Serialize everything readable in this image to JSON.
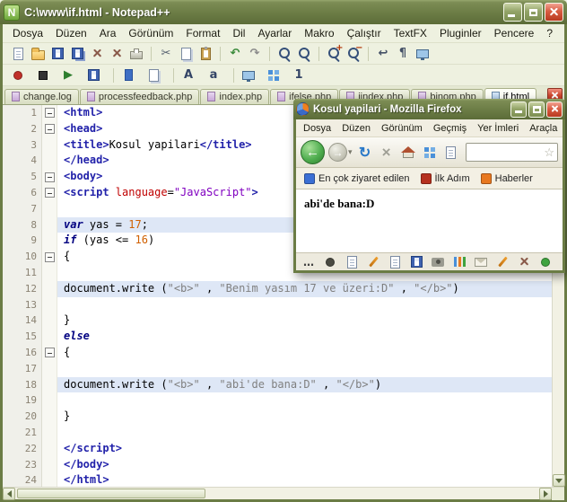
{
  "notepad": {
    "title": "C:\\www\\if.html - Notepad++",
    "app_icon_letter": "N",
    "menu_items": [
      "Dosya",
      "Düzen",
      "Ara",
      "Görünüm",
      "Format",
      "Dil",
      "Ayarlar",
      "Makro",
      "Çalıştır",
      "TextFX",
      "Pluginler",
      "Pencere",
      "?"
    ],
    "toolbar_row1": [
      {
        "name": "new-file-icon",
        "kind": "page"
      },
      {
        "name": "open-file-icon",
        "kind": "folder"
      },
      {
        "name": "save-icon",
        "kind": "floppy"
      },
      {
        "name": "save-all-icon",
        "kind": "floppy2"
      },
      {
        "name": "close-file-icon",
        "kind": "xgray"
      },
      {
        "name": "close-all-icon",
        "kind": "xgray"
      },
      {
        "name": "print-icon",
        "kind": "printer"
      },
      {
        "sep": true
      },
      {
        "name": "cut-icon",
        "kind": "char",
        "glyph": "✂",
        "color": "#556070"
      },
      {
        "name": "copy-icon",
        "kind": "page2"
      },
      {
        "name": "paste-icon",
        "kind": "clipboard"
      },
      {
        "sep": true
      },
      {
        "name": "undo-icon",
        "kind": "char",
        "glyph": "↶",
        "color": "#3A8A3A"
      },
      {
        "name": "redo-icon",
        "kind": "char",
        "glyph": "↷",
        "color": "#8A8A8A"
      },
      {
        "sep": true
      },
      {
        "name": "find-icon",
        "kind": "zoom"
      },
      {
        "name": "find-replace-icon",
        "kind": "zoom"
      },
      {
        "sep": true
      },
      {
        "name": "zoom-in-icon",
        "kind": "zoom",
        "glyph": "+"
      },
      {
        "name": "zoom-out-icon",
        "kind": "zoom",
        "glyph": "−"
      },
      {
        "sep": true
      },
      {
        "name": "word-wrap-icon",
        "kind": "char",
        "glyph": "↩",
        "color": "#445066"
      },
      {
        "name": "show-symbols-icon",
        "kind": "char",
        "glyph": "¶",
        "color": "#445066"
      },
      {
        "name": "doc-monitor-icon",
        "kind": "monitor"
      }
    ],
    "toolbar_row2": [
      {
        "name": "macro-record-icon",
        "kind": "dot",
        "color": "#C03028"
      },
      {
        "name": "macro-stop-icon",
        "kind": "stopsq"
      },
      {
        "name": "macro-play-icon",
        "kind": "char",
        "glyph": "▶",
        "color": "#2E7E2E"
      },
      {
        "name": "macro-save-icon",
        "kind": "floppy"
      },
      {
        "sep": true
      },
      {
        "name": "bookmark-icon",
        "kind": "bookmarkic"
      },
      {
        "name": "doc-pair-icon",
        "kind": "page2"
      },
      {
        "sep": true
      },
      {
        "name": "uppercase-icon",
        "kind": "char",
        "glyph": "A",
        "color": "#334466"
      },
      {
        "name": "lowercase-icon",
        "kind": "char",
        "glyph": "a",
        "color": "#334466"
      },
      {
        "sep": true
      },
      {
        "name": "doc-map-icon",
        "kind": "monitor"
      },
      {
        "name": "function-list-icon",
        "kind": "grid"
      },
      {
        "name": "doc-switcher-icon",
        "kind": "char",
        "glyph": "1",
        "color": "#334466"
      }
    ],
    "tabs": [
      {
        "label": "change.log",
        "active": false
      },
      {
        "label": "processfeedback.php",
        "active": false
      },
      {
        "label": "index.php",
        "active": false
      },
      {
        "label": "ifelse.php",
        "active": false
      },
      {
        "label": "iindex.php",
        "active": false
      },
      {
        "label": "binom.php",
        "active": false
      },
      {
        "label": "if.html",
        "active": true
      }
    ],
    "editor": {
      "lines": [
        {
          "n": 1,
          "fold": true,
          "segs": [
            {
              "t": "<html>",
              "c": "t"
            }
          ]
        },
        {
          "n": 2,
          "fold": true,
          "segs": [
            {
              "t": "<head>",
              "c": "t"
            }
          ]
        },
        {
          "n": 3,
          "segs": [
            {
              "t": "<title>",
              "c": "t"
            },
            {
              "t": "Kosul yapilari",
              "c": "p"
            },
            {
              "t": "</title>",
              "c": "t"
            }
          ]
        },
        {
          "n": 4,
          "segs": [
            {
              "t": "</head>",
              "c": "t"
            }
          ]
        },
        {
          "n": 5,
          "fold": true,
          "segs": [
            {
              "t": "<body>",
              "c": "t"
            }
          ]
        },
        {
          "n": 6,
          "fold": true,
          "segs": [
            {
              "t": "<script ",
              "c": "t"
            },
            {
              "t": "language",
              "c": "a"
            },
            {
              "t": "=",
              "c": "p"
            },
            {
              "t": "\"JavaScript\"",
              "c": "v"
            },
            {
              "t": ">",
              "c": "t"
            }
          ]
        },
        {
          "n": 7,
          "segs": []
        },
        {
          "n": 8,
          "hl": true,
          "segs": [
            {
              "t": "var",
              "c": "k"
            },
            {
              "t": " yas = ",
              "c": "p"
            },
            {
              "t": "17",
              "c": "n"
            },
            {
              "t": ";",
              "c": "p"
            }
          ]
        },
        {
          "n": 9,
          "segs": [
            {
              "t": "if",
              "c": "k"
            },
            {
              "t": " (yas <= ",
              "c": "p"
            },
            {
              "t": "16",
              "c": "n"
            },
            {
              "t": ")",
              "c": "p"
            }
          ]
        },
        {
          "n": 10,
          "fold": true,
          "segs": [
            {
              "t": "{",
              "c": "p"
            }
          ]
        },
        {
          "n": 11,
          "segs": []
        },
        {
          "n": 12,
          "hl": true,
          "segs": [
            {
              "t": "document.write (",
              "c": "p"
            },
            {
              "t": "\"<b>\"",
              "c": "s"
            },
            {
              "t": " , ",
              "c": "p"
            },
            {
              "t": "\"Benim yasım 17 ve üzeri:D\"",
              "c": "s"
            },
            {
              "t": " , ",
              "c": "p"
            },
            {
              "t": "\"</b>\"",
              "c": "s"
            },
            {
              "t": ")",
              "c": "p"
            }
          ]
        },
        {
          "n": 13,
          "segs": []
        },
        {
          "n": 14,
          "segs": [
            {
              "t": "}",
              "c": "p"
            }
          ]
        },
        {
          "n": 15,
          "segs": [
            {
              "t": "else",
              "c": "k"
            }
          ]
        },
        {
          "n": 16,
          "fold": true,
          "segs": [
            {
              "t": "{",
              "c": "p"
            }
          ]
        },
        {
          "n": 17,
          "segs": []
        },
        {
          "n": 18,
          "hl": true,
          "segs": [
            {
              "t": "document.write (",
              "c": "p"
            },
            {
              "t": "\"<b>\"",
              "c": "s"
            },
            {
              "t": " , ",
              "c": "p"
            },
            {
              "t": "\"abi'de bana:D\"",
              "c": "s"
            },
            {
              "t": " , ",
              "c": "p"
            },
            {
              "t": "\"</b>\"",
              "c": "s"
            },
            {
              "t": ")",
              "c": "p"
            }
          ]
        },
        {
          "n": 19,
          "segs": []
        },
        {
          "n": 20,
          "segs": [
            {
              "t": "}",
              "c": "p"
            }
          ]
        },
        {
          "n": 21,
          "segs": []
        },
        {
          "n": 22,
          "segs": [
            {
              "t": "</script>",
              "c": "t"
            }
          ]
        },
        {
          "n": 23,
          "segs": [
            {
              "t": "</body>",
              "c": "t"
            }
          ]
        },
        {
          "n": 24,
          "segs": [
            {
              "t": "</html>",
              "c": "t"
            }
          ]
        }
      ]
    }
  },
  "firefox": {
    "title": "Kosul yapilari - Mozilla Firefox",
    "menu_items": [
      "Dosya",
      "Düzen",
      "Görünüm",
      "Geçmiş",
      "Yer İmleri",
      "Araçla"
    ],
    "nav": {
      "back_glyph": "←",
      "forward_glyph": "→",
      "dropdown_glyph": "▾",
      "refresh_glyph": "↻",
      "stop_glyph": "×",
      "star_glyph": "☆"
    },
    "bookmarks": [
      {
        "label": "En çok ziyaret edilen",
        "color": "#3B6FD4"
      },
      {
        "label": "İlk Adım",
        "color": "#B5301E"
      },
      {
        "label": "Haberler",
        "color": "#E87820"
      }
    ],
    "content_text": "abi'de bana:D",
    "addon_icons": [
      {
        "name": "more-options-icon",
        "kind": "char",
        "glyph": "…",
        "color": "#444444"
      },
      {
        "name": "paw-icon",
        "kind": "dot",
        "color": "#4A4A42"
      },
      {
        "name": "document-icon",
        "kind": "page"
      },
      {
        "name": "edit-pencil-icon",
        "kind": "pencil"
      },
      {
        "name": "document2-icon",
        "kind": "page"
      },
      {
        "name": "save-small-icon",
        "kind": "floppy"
      },
      {
        "name": "camera-icon",
        "kind": "camera"
      },
      {
        "name": "chart-icon",
        "kind": "chart"
      },
      {
        "name": "mail-icon",
        "kind": "envelope"
      },
      {
        "name": "pencil2-icon",
        "kind": "pencil"
      },
      {
        "name": "close-small-icon",
        "kind": "xgray"
      },
      {
        "name": "status-green-icon",
        "kind": "dot",
        "color": "#3FA33F"
      }
    ]
  }
}
